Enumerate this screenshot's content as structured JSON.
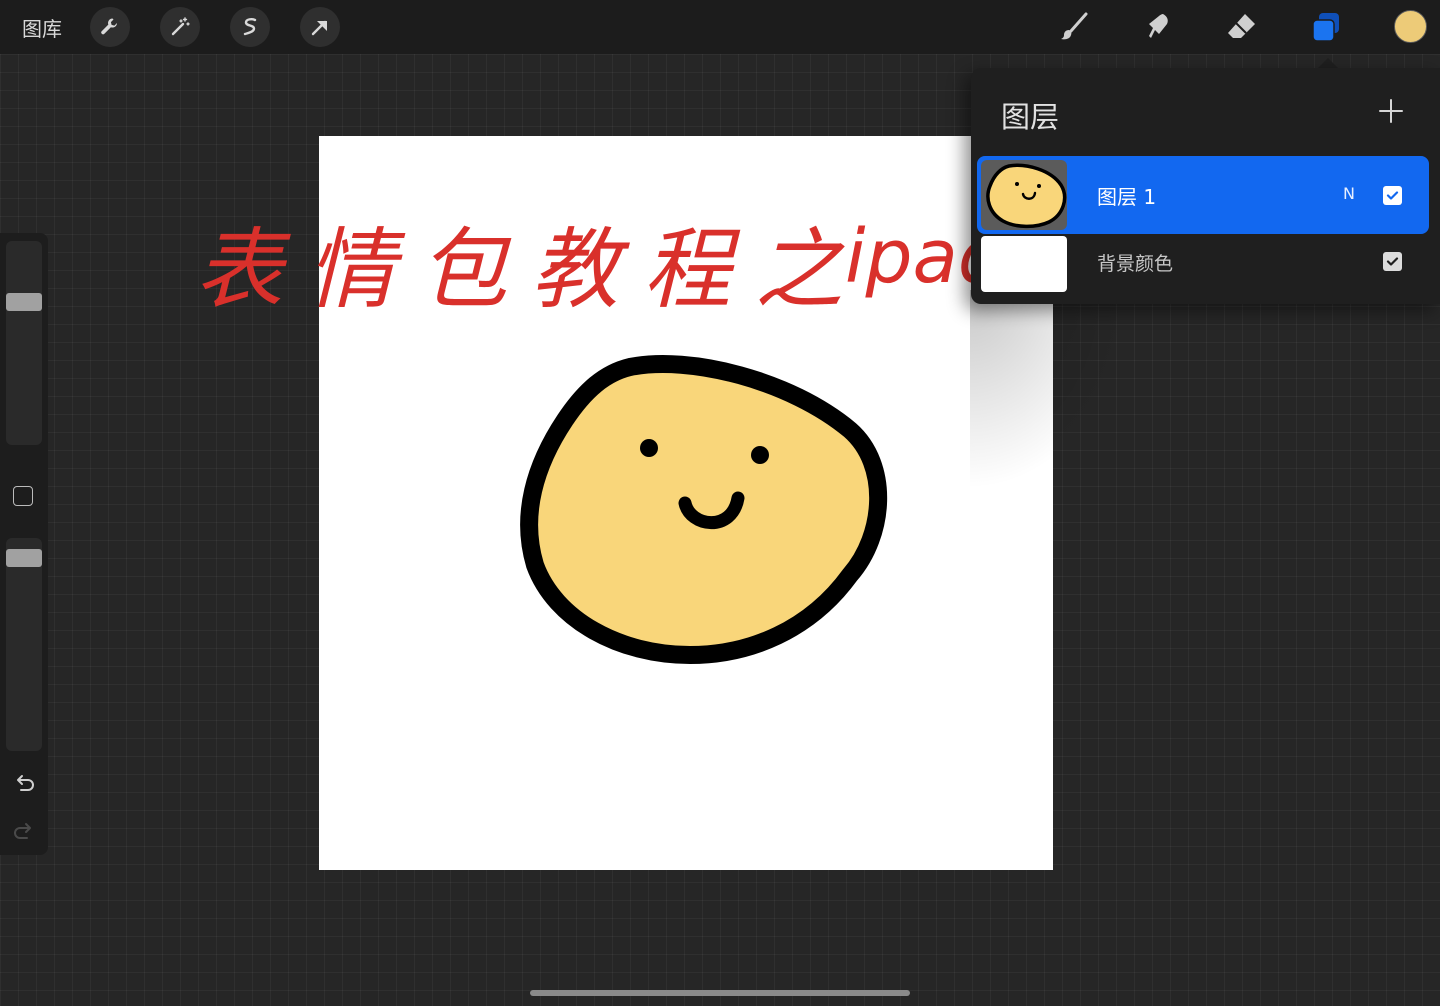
{
  "toolbar": {
    "gallery_label": "图库",
    "left_tools": [
      "wrench-icon",
      "magic-wand-icon",
      "selection-icon",
      "transform-arrow-icon"
    ],
    "right_tools": [
      "brush-icon",
      "smudge-icon",
      "eraser-icon",
      "layers-icon"
    ],
    "current_color": "#EDCB78",
    "active_tool_color": "#1B74F0"
  },
  "sidebar": {
    "brush_size": 0.72,
    "opacity": 1.0,
    "icons": [
      "modify-square-icon",
      "undo-icon",
      "redo-icon"
    ]
  },
  "canvas": {
    "overlay_text_cn": "表情包教程之",
    "overlay_text_en": "ipad版",
    "overlay_color": "#D9302B",
    "face_fill": "#F9D67A",
    "outline_color": "#000000"
  },
  "layers_panel": {
    "title": "图层",
    "add_icon": "plus-icon",
    "layers": [
      {
        "name": "图层 1",
        "blend": "N",
        "visible": true,
        "selected": true
      },
      {
        "name": "背景颜色",
        "visible": true,
        "selected": false
      }
    ],
    "selected_color": "#1268F0"
  }
}
